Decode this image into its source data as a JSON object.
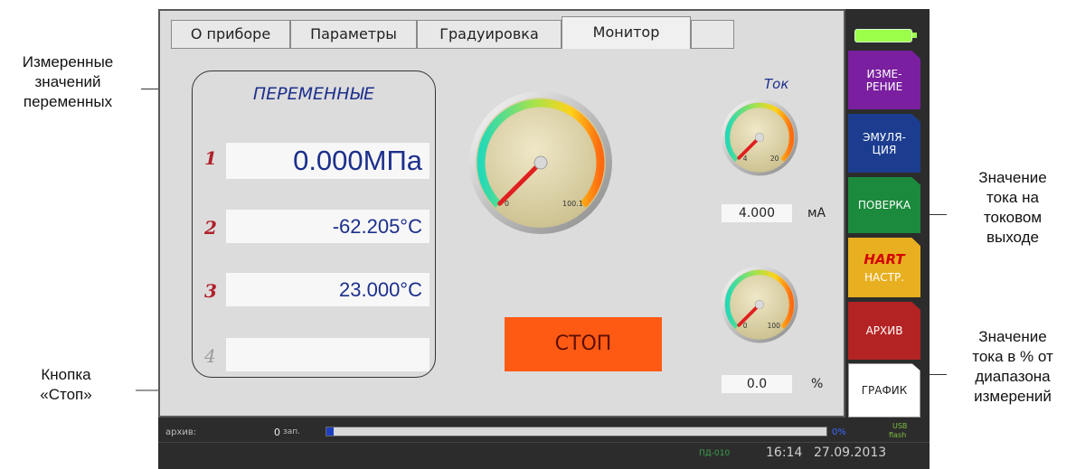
{
  "tabs": [
    {
      "label": "О приборе"
    },
    {
      "label": "Параметры"
    },
    {
      "label": "Градуировка"
    },
    {
      "label": "Монитор",
      "active": true
    },
    {
      "label": ""
    }
  ],
  "variables": {
    "title": "ПЕРЕМЕННЫЕ",
    "rows": [
      {
        "num": "1",
        "value": "0.000МПа"
      },
      {
        "num": "2",
        "value": "-62.205°C"
      },
      {
        "num": "3",
        "value": "23.000°C"
      },
      {
        "num": "4",
        "value": ""
      }
    ]
  },
  "main_gauge": {
    "min_label": "0",
    "max_label": "100.1",
    "value_fraction": 0.0
  },
  "current": {
    "label": "Ток",
    "gauge": {
      "min_label": "4",
      "max_label": "20",
      "value_fraction": 0.0
    },
    "value": "4.000",
    "unit": "мА"
  },
  "percent": {
    "gauge": {
      "min_label": "0",
      "max_label": "100",
      "value_fraction": 0.0
    },
    "value": "0.0",
    "unit": "%"
  },
  "stop_button": {
    "label": "СТОП"
  },
  "side_menu": [
    {
      "label": "ИЗМЕ-\nРЕНИЕ",
      "color": "#7a1fa0"
    },
    {
      "label": "ЭМУЛЯ-\nЦИЯ",
      "color": "#1c3d8f"
    },
    {
      "label": "ПОВЕРКА",
      "color": "#1b8a3c"
    },
    {
      "label_top": "HART",
      "label": "НАСТР.",
      "color": "#e8b020"
    },
    {
      "label": "АРХИВ",
      "color": "#b42323"
    },
    {
      "label": "ГРАФИК",
      "color": "#ffffff"
    }
  ],
  "battery_icon": "battery-icon",
  "status": {
    "archive_label": "архив:",
    "records_count": "0",
    "records_unit": "зап.",
    "progress_percent": 0,
    "progress_text": "0%",
    "usb_line1": "USB",
    "usb_line2": "flash",
    "device": "ПД-010",
    "time": "16:14",
    "date": "27.09.2013"
  },
  "callouts": {
    "measured": "Измеренные\nзначений\nпеременных",
    "current_output": "Значение\nтока на\nтоковом\nвыходе",
    "stop_button": "Кнопка\n«Стоп»",
    "percent_range": "Значение\nтока в % от\nдиапазона\nизмерений"
  },
  "colors": {
    "panel_bg": "#dcdcdc",
    "stop_button": "#ff5a14",
    "variable_value": "#1c2f8c",
    "variable_number": "#b0202a",
    "needle": "#e02020"
  }
}
